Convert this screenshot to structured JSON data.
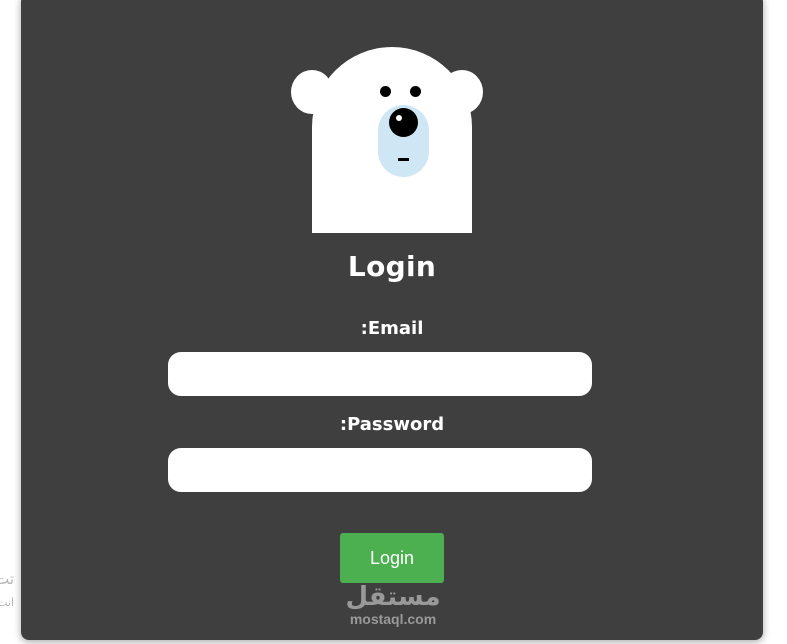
{
  "background_text": {
    "line1": "تت",
    "line2": "انت"
  },
  "bear": {
    "icon": "polar-bear-icon",
    "colors": {
      "fur": "#ffffff",
      "muzzle": "#cfe7f4",
      "features": "#000000"
    }
  },
  "login_form": {
    "title": "Login",
    "email_label": ":Email",
    "email_value": "",
    "password_label": ":Password",
    "password_value": "",
    "submit_label": "Login"
  },
  "watermark": {
    "arabic": "مستقل",
    "latin": "mostaql.com"
  },
  "colors": {
    "card_background": "#3f3f3f",
    "button": "#4caf50",
    "text": "#ffffff"
  }
}
